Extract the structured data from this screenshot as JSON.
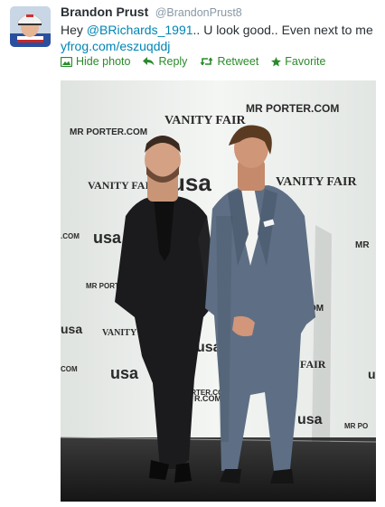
{
  "user": {
    "display_name": "Brandon Prust",
    "handle": "@BrandonPrust8"
  },
  "tweet": {
    "text_before": "Hey ",
    "mention": "@BRichards_1991",
    "text_after": ".. U look good.. Even next to me",
    "link": "yfrog.com/eszuqddj"
  },
  "actions": {
    "hide_photo": "Hide photo",
    "reply": "Reply",
    "retweet": "Retweet",
    "favorite": "Favorite"
  },
  "photo": {
    "backdrop_logos": [
      "MR PORTER.COM",
      "VANITY FAIR",
      "MR PORTER.COM",
      "VANITY FAIR",
      "usa",
      "VANITY FAIR",
      "usa",
      ".COM",
      "MR",
      "MR PORTER",
      "VANITY",
      "usa",
      ".COM",
      "usa",
      "R.COM",
      "FAIR",
      "usa",
      "MR PORTER.COM",
      "MR PO",
      "COM",
      "usa",
      "usa"
    ]
  },
  "colors": {
    "link": "#0084b4",
    "action": "#2b8a2b",
    "name": "#292f33",
    "handle": "#8899a6"
  }
}
